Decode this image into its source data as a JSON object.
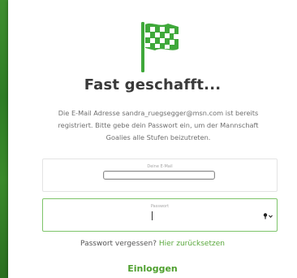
{
  "heading": {
    "title": "Fast geschafft..."
  },
  "description": {
    "line1": "Die E-Mail Adresse sandra_ruegsegger@msn.com ist bereits",
    "line2": "registriert. Bitte gebe dein Passwort ein, um der Mannschaft",
    "line3": "Goalies alle Stufen beizutreten."
  },
  "email_field": {
    "label": "Deine E-Mail",
    "value": ""
  },
  "password_field": {
    "label": "Passwort",
    "value": ""
  },
  "forgot": {
    "prefix": "Passwort vergessen?",
    "link": "Hier zurücksetzen"
  },
  "login": {
    "label": "Einloggen"
  },
  "icons": {
    "flag": "checkered-flag-icon",
    "key": "key-icon"
  },
  "colors": {
    "accent": "#4fa02f",
    "flag_green": "#3fa83a",
    "focus_border": "#7ec46a",
    "background_strip": "#3a8a2a"
  }
}
